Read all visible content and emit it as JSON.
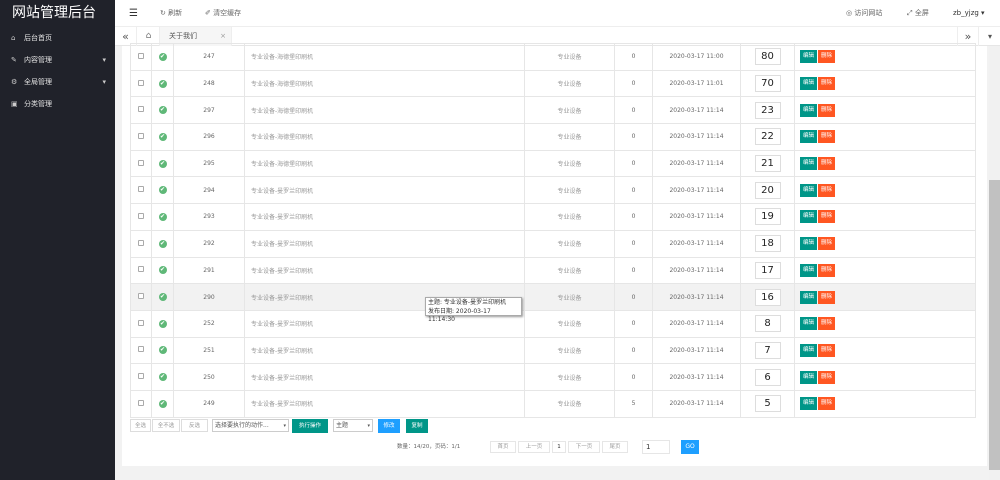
{
  "sidebar": {
    "logo": "网站管理后台",
    "items": [
      {
        "label": "后台首页",
        "icon": "home-icon",
        "glyph": "⌂",
        "arrow": ""
      },
      {
        "label": "内容管理",
        "icon": "edit-icon",
        "glyph": "✎",
        "arrow": "▾"
      },
      {
        "label": "全局管理",
        "icon": "gear-icon",
        "glyph": "⚙",
        "arrow": "▾"
      },
      {
        "label": "分类管理",
        "icon": "folder-icon",
        "glyph": "▣",
        "arrow": ""
      }
    ]
  },
  "topbar": {
    "menu_glyph": "☰",
    "refresh": "↻ 刷新",
    "clear_cache": "✐ 清空缓存",
    "visit_site": "◎ 访问网站",
    "fullscreen": "⤢ 全屏",
    "user": "zb_yjzg ▾"
  },
  "tabs": {
    "prev": "«",
    "home": "⌂",
    "active": "关于我们",
    "close": "×",
    "next": "»",
    "more": "▾"
  },
  "table": {
    "ok_glyph": "✔",
    "edit_label": "编辑",
    "delete_label": "删除",
    "rows": [
      {
        "id": "247",
        "title": "专业设备-海德堡印刷机",
        "category": "专业设备",
        "views": "0",
        "date": "2020-03-17 11:00",
        "order": "80"
      },
      {
        "id": "248",
        "title": "专业设备-海德堡印刷机",
        "category": "专业设备",
        "views": "0",
        "date": "2020-03-17 11:01",
        "order": "70"
      },
      {
        "id": "297",
        "title": "专业设备-海德堡印刷机",
        "category": "专业设备",
        "views": "0",
        "date": "2020-03-17 11:14",
        "order": "23"
      },
      {
        "id": "296",
        "title": "专业设备-海德堡印刷机",
        "category": "专业设备",
        "views": "0",
        "date": "2020-03-17 11:14",
        "order": "22"
      },
      {
        "id": "295",
        "title": "专业设备-海德堡印刷机",
        "category": "专业设备",
        "views": "0",
        "date": "2020-03-17 11:14",
        "order": "21"
      },
      {
        "id": "294",
        "title": "专业设备-曼罗兰印刷机",
        "category": "专业设备",
        "views": "0",
        "date": "2020-03-17 11:14",
        "order": "20"
      },
      {
        "id": "293",
        "title": "专业设备-曼罗兰印刷机",
        "category": "专业设备",
        "views": "0",
        "date": "2020-03-17 11:14",
        "order": "19"
      },
      {
        "id": "292",
        "title": "专业设备-曼罗兰印刷机",
        "category": "专业设备",
        "views": "0",
        "date": "2020-03-17 11:14",
        "order": "18"
      },
      {
        "id": "291",
        "title": "专业设备-曼罗兰印刷机",
        "category": "专业设备",
        "views": "0",
        "date": "2020-03-17 11:14",
        "order": "17"
      },
      {
        "id": "290",
        "title": "专业设备-曼罗兰印刷机",
        "category": "专业设备",
        "views": "0",
        "date": "2020-03-17 11:14",
        "order": "16"
      },
      {
        "id": "252",
        "title": "专业设备-曼罗兰印刷机",
        "category": "专业设备",
        "views": "0",
        "date": "2020-03-17 11:14",
        "order": "8"
      },
      {
        "id": "251",
        "title": "专业设备-曼罗兰印刷机",
        "category": "专业设备",
        "views": "0",
        "date": "2020-03-17 11:14",
        "order": "7"
      },
      {
        "id": "250",
        "title": "专业设备-曼罗兰印刷机",
        "category": "专业设备",
        "views": "0",
        "date": "2020-03-17 11:14",
        "order": "6"
      },
      {
        "id": "249",
        "title": "专业设备-曼罗兰印刷机",
        "category": "专业设备",
        "views": "5",
        "date": "2020-03-17 11:14",
        "order": "5"
      }
    ]
  },
  "toolbar": {
    "select_all": "全选",
    "select_none": "全不选",
    "invert": "反选",
    "action_select": "选择要执行的动作...",
    "execute": "执行操作",
    "subject_select": "主题",
    "modify": "修改",
    "copy": "复制",
    "dropdown_glyph": "▾"
  },
  "pager": {
    "summary": "数量：14/20，页码：1/1",
    "first": "首页",
    "prev": "上一页",
    "current": "1",
    "next": "下一页",
    "last": "尾页",
    "goto_value": "1",
    "go": "GO"
  },
  "tooltip": {
    "line1": "主题: 专业设备-曼罗兰印刷机",
    "line2": "发布日期: 2020-03-17 11:14:30"
  },
  "colors": {
    "sidebar_bg": "#20222a",
    "edit_green": "#009688",
    "delete_orange": "#ff5722",
    "go_blue": "#1e9fff",
    "status_green": "#5fb878"
  }
}
